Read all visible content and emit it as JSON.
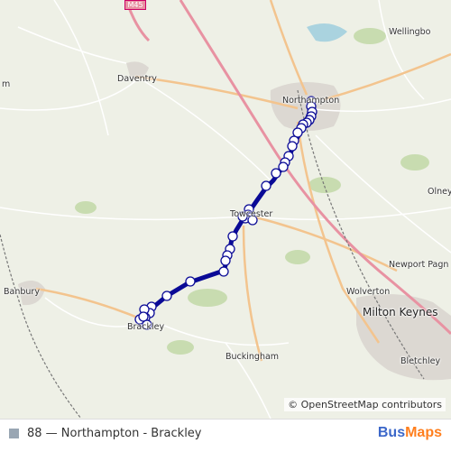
{
  "map": {
    "places": [
      {
        "name": "Wellingborough",
        "display": "Wellingbo",
        "size": "small"
      },
      {
        "name": "Daventry",
        "display": "Daventry",
        "size": "small"
      },
      {
        "name": "Northampton",
        "display": "Northampton",
        "size": "small"
      },
      {
        "name": "Towcester",
        "display": "Towcester",
        "size": "small"
      },
      {
        "name": "Olney",
        "display": "Olney",
        "size": "small"
      },
      {
        "name": "Banbury",
        "display": "Banbury",
        "size": "small"
      },
      {
        "name": "Newport Pagnell",
        "display": "Newport Pagn",
        "size": "small"
      },
      {
        "name": "Wolverton",
        "display": "Wolverton",
        "size": "small"
      },
      {
        "name": "Milton Keynes",
        "display": "Milton Keynes",
        "size": "big"
      },
      {
        "name": "Brackley",
        "display": "Brackley",
        "size": "small"
      },
      {
        "name": "Buckingham",
        "display": "Buckingham",
        "size": "small"
      },
      {
        "name": "Bletchley",
        "display": "Bletchley",
        "size": "small"
      },
      {
        "name": "m",
        "display": "m",
        "size": "small"
      }
    ],
    "motorway_label": "M45",
    "route_color": "#0a0a96",
    "stop_fill": "#ffffff",
    "attribution": "© OpenStreetMap contributors"
  },
  "footer": {
    "route_label": "88 — Northampton - Brackley",
    "swatch_color": "#99a6b3",
    "brand_part1": "Bus",
    "brand_part2": "Maps"
  }
}
